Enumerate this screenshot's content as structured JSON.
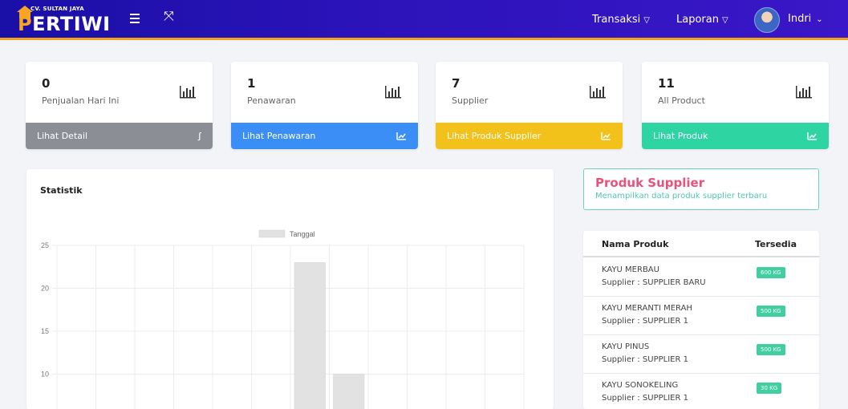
{
  "header": {
    "logo_small": "CV. SULTAN JAYA",
    "logo_p": "P",
    "logo_rest": "ERTIWI",
    "nav": [
      {
        "label": "Transaksi"
      },
      {
        "label": "Laporan"
      }
    ],
    "user": "Indri",
    "colors": {
      "bar": "#2a13b8",
      "accent": "#f0a21a"
    }
  },
  "cards": [
    {
      "value": "0",
      "label": "Penjualan Hari Ini",
      "footer": "Lihat Detail",
      "icon": "bar-chart-icon",
      "footer_icon": "run-icon",
      "color": "#8b8f95"
    },
    {
      "value": "1",
      "label": "Penawaran",
      "footer": "Lihat Penawaran",
      "icon": "bar-chart-icon",
      "footer_icon": "trend-icon",
      "color": "#3a8ef6"
    },
    {
      "value": "7",
      "label": "Supplier",
      "footer": "Lihat Produk Supplier",
      "icon": "bar-chart-icon",
      "footer_icon": "trend-icon",
      "color": "#f2c21a"
    },
    {
      "value": "11",
      "label": "All Product",
      "footer": "Lihat Produk",
      "icon": "bar-chart-icon",
      "footer_icon": "trend-icon",
      "color": "#2fd4a3"
    }
  ],
  "statistik": {
    "title": "Statistik"
  },
  "chart_data": {
    "type": "bar",
    "title": "",
    "legend": "Tanggal",
    "legend_position": "top-center",
    "categories": [
      "",
      "",
      "",
      "",
      "",
      "",
      "",
      "",
      "",
      "",
      "",
      ""
    ],
    "values": [
      0,
      0,
      0,
      0,
      0,
      0,
      23,
      10,
      0,
      0,
      0,
      0
    ],
    "y_ticks": [
      10,
      15,
      20,
      25
    ],
    "ylim": [
      5,
      25
    ],
    "grid": true,
    "bar_color": "#e2e2e2"
  },
  "produk_supplier": {
    "title": "Produk Supplier",
    "subtitle": "Menampilkan data produk supplier terbaru",
    "columns": [
      "Nama Produk",
      "Tersedia"
    ],
    "rows": [
      {
        "name": "KAYU MERBAU",
        "supplier": "Supplier : SUPPLIER BARU",
        "stock": "600 KG"
      },
      {
        "name": "KAYU MERANTI MERAH",
        "supplier": "Supplier : SUPPLIER 1",
        "stock": "500 KG"
      },
      {
        "name": "KAYU PINUS",
        "supplier": "Supplier : SUPPLIER 1",
        "stock": "500 KG"
      },
      {
        "name": "KAYU SONOKELING",
        "supplier": "Supplier : SUPPLIER 1",
        "stock": "30 KG"
      }
    ]
  }
}
